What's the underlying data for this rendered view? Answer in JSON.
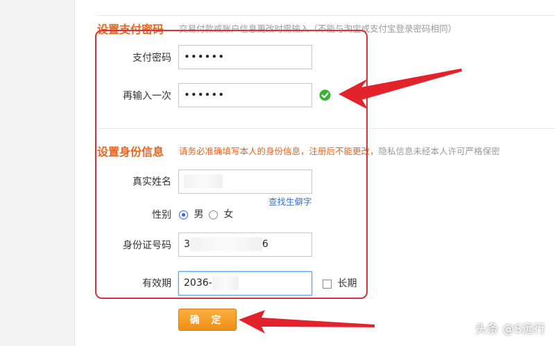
{
  "payment_password_section": {
    "title": "设置支付密码",
    "hint": "交易付款或账户信息更改时需输入（不能与淘宝或支付宝登录密码相同）",
    "password_label": "支付密码",
    "password_value": "••••••",
    "confirm_label": "再输入一次",
    "confirm_value": "••••••"
  },
  "identity_section": {
    "title": "设置身份信息",
    "hint_warning": "请务必准确填写本人的身份信息，注册后不能更改，",
    "hint_privacy": "隐私信息未经本人许可严格保密",
    "name_label": "真实姓名",
    "rare_char_link": "查找生僻字",
    "gender_label": "性别",
    "gender_male": "男",
    "gender_female": "女",
    "id_label": "身份证号码",
    "id_prefix": "3",
    "id_suffix": "6",
    "validity_label": "有效期",
    "validity_value": "2036-",
    "long_term_label": "长期"
  },
  "confirm_button": "确 定",
  "watermark": "头条 @S远行",
  "colors": {
    "accent_orange": "#e8641e",
    "annotation_red": "#d9323c",
    "link_blue": "#3a73c9",
    "success_green": "#3db135"
  }
}
